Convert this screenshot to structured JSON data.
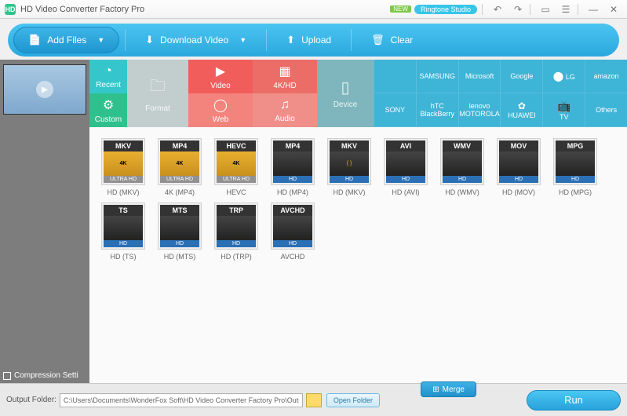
{
  "title": "HD Video Converter Factory Pro",
  "titlebar": {
    "new_badge": "NEW",
    "ringtone": "Ringtone Studio"
  },
  "toolbar": {
    "add": "Add Files",
    "download": "Download Video",
    "upload": "Upload",
    "clear": "Clear"
  },
  "sidebar": {
    "recent": "Recent",
    "custom": "Custom",
    "format": "Format",
    "video": "Video",
    "web": "Web",
    "k4": "4K/HD",
    "audio": "Audio",
    "device": "Device"
  },
  "brands": [
    "",
    "SAMSUNG",
    "Microsoft",
    "Google",
    "LG",
    "amazon",
    "SONY",
    "hTC\nBlackBerry",
    "lenovo\nMOTOROLA",
    "HUAWEI",
    "TV",
    "Others"
  ],
  "formats": [
    {
      "badge": "MKV",
      "mid": "4K",
      "bot": "ULTRA HD",
      "botcls": "",
      "label": "HD (MKV)"
    },
    {
      "badge": "MP4",
      "mid": "4K",
      "bot": "ULTRA HD",
      "botcls": "",
      "label": "4K (MP4)"
    },
    {
      "badge": "HEVC",
      "mid": "4K",
      "bot": "ULTRA HD",
      "botcls": "",
      "label": "HEVC"
    },
    {
      "badge": "MP4",
      "mid": "",
      "bot": "HD",
      "botcls": "hd",
      "label": "HD (MP4)"
    },
    {
      "badge": "MKV",
      "mid": "{ }",
      "bot": "HD",
      "botcls": "hd",
      "label": "HD (MKV)"
    },
    {
      "badge": "AVI",
      "mid": "",
      "bot": "HD",
      "botcls": "hd",
      "label": "HD (AVI)"
    },
    {
      "badge": "WMV",
      "mid": "",
      "bot": "HD",
      "botcls": "hd",
      "label": "HD (WMV)"
    },
    {
      "badge": "MOV",
      "mid": "",
      "bot": "HD",
      "botcls": "hd",
      "label": "HD (MOV)"
    },
    {
      "badge": "MPG",
      "mid": "",
      "bot": "HD",
      "botcls": "hd",
      "label": "HD (MPG)"
    },
    {
      "badge": "TS",
      "mid": "",
      "bot": "HD",
      "botcls": "hd",
      "label": "HD (TS)"
    },
    {
      "badge": "MTS",
      "mid": "",
      "bot": "HD",
      "botcls": "hd",
      "label": "HD (MTS)"
    },
    {
      "badge": "TRP",
      "mid": "",
      "bot": "HD",
      "botcls": "hd",
      "label": "HD (TRP)"
    },
    {
      "badge": "AVCHD",
      "mid": "",
      "bot": "HD",
      "botcls": "hd",
      "label": "AVCHD"
    }
  ],
  "bottom": {
    "label": "Output Folder:",
    "path": "C:\\Users\\Documents\\WonderFox Soft\\HD Video Converter Factory Pro\\Output",
    "open": "Open Folder",
    "merge": "Merge",
    "run": "Run",
    "compression": "Compression Setti"
  }
}
